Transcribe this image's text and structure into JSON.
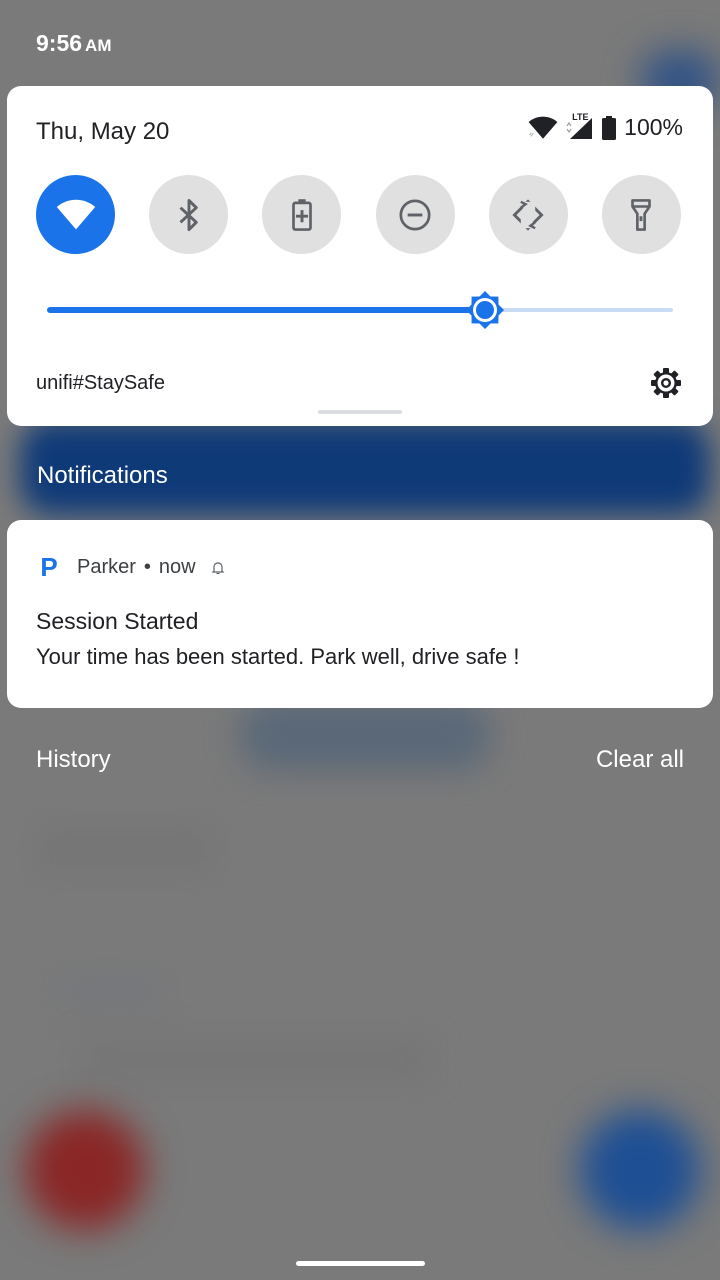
{
  "status_bar": {
    "time": "9:56",
    "ampm": "AM"
  },
  "quick_settings": {
    "date": "Thu, May 20",
    "battery": "100%",
    "network_label": "LTE",
    "tiles": [
      {
        "name": "wifi",
        "active": true
      },
      {
        "name": "bluetooth",
        "active": false
      },
      {
        "name": "battery-saver",
        "active": false
      },
      {
        "name": "do-not-disturb",
        "active": false
      },
      {
        "name": "auto-rotate",
        "active": false
      },
      {
        "name": "flashlight",
        "active": false
      }
    ],
    "brightness_level": 0.7,
    "wifi_network": "unifi#StaySafe"
  },
  "notifications": {
    "header": "Notifications",
    "items": [
      {
        "app_initial": "P",
        "app_name": "Parker",
        "separator": "•",
        "time": "now",
        "title": "Session Started",
        "text": "Your time has been started. Park well, drive safe !"
      }
    ],
    "history_label": "History",
    "clear_all_label": "Clear all"
  },
  "colors": {
    "accent": "#1a73e8",
    "tile_inactive": "#e0e0e0",
    "scrim": "#7a7a7a"
  }
}
